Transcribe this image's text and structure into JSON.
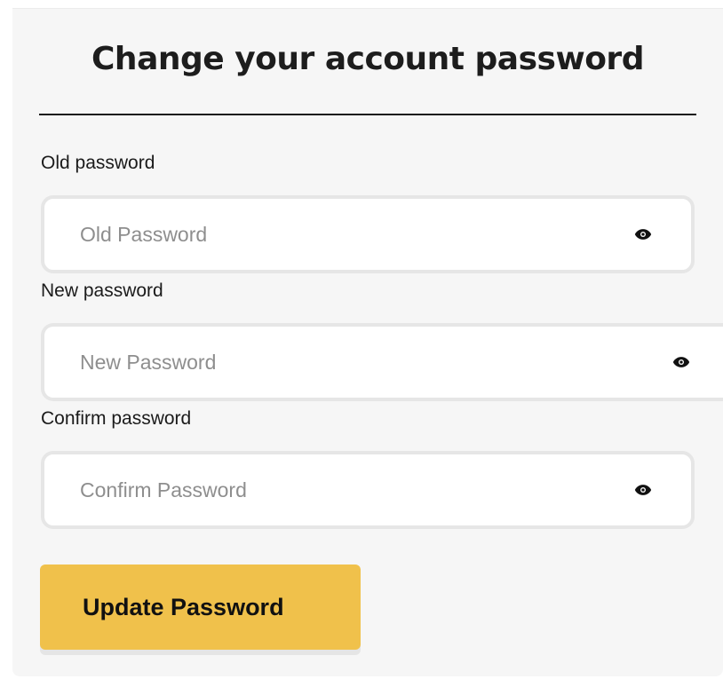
{
  "form": {
    "title": "Change your account password",
    "old_password": {
      "label": "Old password",
      "placeholder": "Old Password",
      "value": ""
    },
    "new_password": {
      "label": "New password",
      "placeholder": "New Password",
      "value": ""
    },
    "confirm_password": {
      "label": "Confirm password",
      "placeholder": "Confirm Password",
      "value": ""
    },
    "submit_label": "Update Password",
    "icons": {
      "toggle_visibility": "eye-icon"
    },
    "colors": {
      "accent": "#f0c14b",
      "card_bg": "#f6f6f6",
      "field_border": "#e6e6e6"
    }
  }
}
